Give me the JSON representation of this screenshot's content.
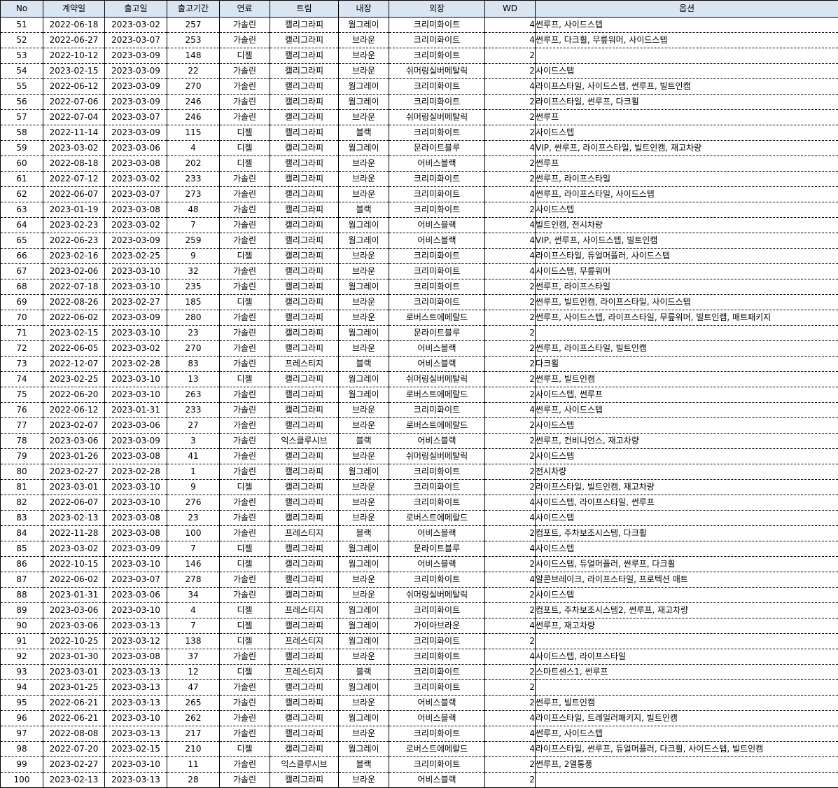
{
  "columns": [
    "No",
    "계약일",
    "출고일",
    "출고기간",
    "연료",
    "트림",
    "내장",
    "외장",
    "WD",
    "옵션"
  ],
  "rows": [
    [
      "51",
      "2022-06-18",
      "2023-03-02",
      "257",
      "가솔린",
      "캘리그라피",
      "웜그레이",
      "크리미화이트",
      "4",
      "썬루프, 사이드스텝"
    ],
    [
      "52",
      "2022-06-27",
      "2023-03-07",
      "253",
      "가솔린",
      "캘리그라피",
      "브라운",
      "크리미화이트",
      "4",
      "썬루프, 다크휠, 무릎워머, 사이드스텝"
    ],
    [
      "53",
      "2022-10-12",
      "2023-03-09",
      "148",
      "디젤",
      "캘리그라피",
      "브라운",
      "크리미화이트",
      "2",
      ""
    ],
    [
      "54",
      "2023-02-15",
      "2023-03-09",
      "22",
      "가솔린",
      "캘리그라피",
      "브라운",
      "쉬머링실버메탈릭",
      "2",
      "사이드스텝"
    ],
    [
      "55",
      "2022-06-12",
      "2023-03-09",
      "270",
      "가솔린",
      "캘리그라피",
      "웜그레이",
      "크리미화이트",
      "4",
      "라이프스타일, 사이드스텝, 썬루프, 빌트인캠"
    ],
    [
      "56",
      "2022-07-06",
      "2023-03-09",
      "246",
      "가솔린",
      "캘리그라피",
      "웜그레이",
      "크리미화이트",
      "2",
      "라이프스타일, 썬루프, 다크휠"
    ],
    [
      "57",
      "2022-07-04",
      "2023-03-07",
      "246",
      "가솔린",
      "캘리그라피",
      "브라운",
      "쉬머링실버메탈릭",
      "2",
      "썬루프"
    ],
    [
      "58",
      "2022-11-14",
      "2023-03-09",
      "115",
      "디젤",
      "캘리그라피",
      "블랙",
      "크리미화이트",
      "2",
      "사이드스텝"
    ],
    [
      "59",
      "2023-03-02",
      "2023-03-06",
      "4",
      "디젤",
      "캘리그라피",
      "웜그레이",
      "문라이트블루",
      "4",
      "VIP, 썬루프, 라이프스타일, 빌트인캠, 재고차량"
    ],
    [
      "60",
      "2022-08-18",
      "2023-03-08",
      "202",
      "디젤",
      "캘리그라피",
      "브라운",
      "어비스블랙",
      "2",
      "썬루프"
    ],
    [
      "61",
      "2022-07-12",
      "2023-03-02",
      "233",
      "가솔린",
      "캘리그라피",
      "브라운",
      "크리미화이트",
      "2",
      "썬루프, 라이프스타일"
    ],
    [
      "62",
      "2022-06-07",
      "2023-03-07",
      "273",
      "가솔린",
      "캘리그라피",
      "브라운",
      "크리미화이트",
      "4",
      "썬루프, 라이프스타일, 사이드스텝"
    ],
    [
      "63",
      "2023-01-19",
      "2023-03-08",
      "48",
      "가솔린",
      "캘리그라피",
      "블랙",
      "크리미화이트",
      "2",
      "사이드스텝"
    ],
    [
      "64",
      "2023-02-23",
      "2023-03-02",
      "7",
      "가솔린",
      "캘리그라피",
      "웜그레이",
      "어비스블랙",
      "4",
      "빌트인캠, 전시차량"
    ],
    [
      "65",
      "2022-06-23",
      "2023-03-09",
      "259",
      "가솔린",
      "캘리그라피",
      "웜그레이",
      "어비스블랙",
      "4",
      "VIP, 썬루프, 사이드스텝, 빌트인캠"
    ],
    [
      "66",
      "2023-02-16",
      "2023-02-25",
      "9",
      "디젤",
      "캘리그라피",
      "브라운",
      "크리미화이트",
      "4",
      "라이프스타일, 듀얼머플러, 사이드스텝"
    ],
    [
      "67",
      "2023-02-06",
      "2023-03-10",
      "32",
      "가솔린",
      "캘리그라피",
      "브라운",
      "크리미화이트",
      "4",
      "사이드스텝, 무릎워머"
    ],
    [
      "68",
      "2022-07-18",
      "2023-03-10",
      "235",
      "가솔린",
      "캘리그라피",
      "웜그레이",
      "크리미화이트",
      "2",
      "썬루프, 라이프스타일"
    ],
    [
      "69",
      "2022-08-26",
      "2023-02-27",
      "185",
      "디젤",
      "캘리그라피",
      "브라운",
      "크리미화이트",
      "2",
      "썬루프, 빌트인캠, 라이프스타일, 사이드스텝"
    ],
    [
      "70",
      "2022-06-02",
      "2023-03-09",
      "280",
      "가솔린",
      "캘리그라피",
      "브라운",
      "로버스트에메랄드",
      "2",
      "썬루프, 사이드스텝, 라이프스타일, 무릎워머, 빌트인캠, 매트패키지"
    ],
    [
      "71",
      "2023-02-15",
      "2023-03-10",
      "23",
      "가솔린",
      "캘리그라피",
      "웜그레이",
      "문라이트블루",
      "2",
      ""
    ],
    [
      "72",
      "2022-06-05",
      "2023-03-02",
      "270",
      "가솔린",
      "캘리그라피",
      "브라운",
      "어비스블랙",
      "2",
      "썬루프, 라이프스타일, 빌트인캠"
    ],
    [
      "73",
      "2022-12-07",
      "2023-02-28",
      "83",
      "가솔린",
      "프레스티지",
      "블랙",
      "어비스블랙",
      "2",
      "다크휠"
    ],
    [
      "74",
      "2023-02-25",
      "2023-03-10",
      "13",
      "디젤",
      "캘리그라피",
      "웜그레이",
      "쉬머링실버메탈릭",
      "2",
      "썬루프, 빌트인캠"
    ],
    [
      "75",
      "2022-06-20",
      "2023-03-10",
      "263",
      "가솔린",
      "캘리그라피",
      "웜그레이",
      "로버스트에메랄드",
      "2",
      "사이드스텝, 썬루프"
    ],
    [
      "76",
      "2022-06-12",
      "2023-01-31",
      "233",
      "가솔린",
      "캘리그라피",
      "브라운",
      "크리미화이트",
      "4",
      "썬루프, 사이드스텝"
    ],
    [
      "77",
      "2023-02-07",
      "2023-03-06",
      "27",
      "가솔린",
      "캘리그라피",
      "브라운",
      "로버스트에메랄드",
      "2",
      "사이드스텝"
    ],
    [
      "78",
      "2023-03-06",
      "2023-03-09",
      "3",
      "가솔린",
      "익스클루시브",
      "블랙",
      "어비스블랙",
      "2",
      "썬루프, 컨비니언스, 재고차량"
    ],
    [
      "79",
      "2023-01-26",
      "2023-03-08",
      "41",
      "가솔린",
      "캘리그라피",
      "브라운",
      "쉬머링실버메탈릭",
      "2",
      "사이드스텝"
    ],
    [
      "80",
      "2023-02-27",
      "2023-02-28",
      "1",
      "가솔린",
      "캘리그라피",
      "웜그레이",
      "크리미화이트",
      "2",
      "전시차량"
    ],
    [
      "81",
      "2023-03-01",
      "2023-03-10",
      "9",
      "디젤",
      "캘리그라피",
      "브라운",
      "크리미화이트",
      "2",
      "라이프스타일, 빌트인캠, 재고차량"
    ],
    [
      "82",
      "2022-06-07",
      "2023-03-10",
      "276",
      "가솔린",
      "캘리그라피",
      "브라운",
      "크리미화이트",
      "4",
      "사이드스텝, 라이프스타일, 썬루프"
    ],
    [
      "83",
      "2023-02-13",
      "2023-03-08",
      "23",
      "가솔린",
      "캘리그라피",
      "브라운",
      "로버스트에메랄드",
      "4",
      "사이드스텝"
    ],
    [
      "84",
      "2022-11-28",
      "2023-03-08",
      "100",
      "가솔린",
      "프레스티지",
      "블랙",
      "어비스블랙",
      "2",
      "컴포트, 주차보조시스템, 다크휠"
    ],
    [
      "85",
      "2023-03-02",
      "2023-03-09",
      "7",
      "디젤",
      "캘리그라피",
      "웜그레이",
      "문라이트블루",
      "4",
      "사이드스텝"
    ],
    [
      "86",
      "2022-10-15",
      "2023-03-10",
      "146",
      "디젤",
      "캘리그라피",
      "웜그레이",
      "어비스블랙",
      "2",
      "사이드스텝, 듀얼머플러, 썬루프, 다크휠"
    ],
    [
      "87",
      "2022-06-02",
      "2023-03-07",
      "278",
      "가솔린",
      "캘리그라피",
      "브라운",
      "크리미화이트",
      "4",
      "알콘브레이크, 라이프스타일, 프로텍션 매트"
    ],
    [
      "88",
      "2023-01-31",
      "2023-03-06",
      "34",
      "가솔린",
      "캘리그라피",
      "브라운",
      "쉬머링실버메탈릭",
      "2",
      "사이드스텝"
    ],
    [
      "89",
      "2023-03-06",
      "2023-03-10",
      "4",
      "디젤",
      "프레스티지",
      "웜그레이",
      "크리미화이트",
      "2",
      "컴포트, 주차보조시스템2, 썬루프, 재고차량"
    ],
    [
      "90",
      "2023-03-06",
      "2023-03-13",
      "7",
      "디젤",
      "캘리그라피",
      "웜그레이",
      "가이아브라운",
      "4",
      "썬루프, 재고차량"
    ],
    [
      "91",
      "2022-10-25",
      "2023-03-12",
      "138",
      "디젤",
      "프레스티지",
      "웜그레이",
      "크리미화이트",
      "2",
      ""
    ],
    [
      "92",
      "2023-01-30",
      "2023-03-08",
      "37",
      "가솔린",
      "캘리그라피",
      "브라운",
      "크리미화이트",
      "4",
      "사이드스텝, 라이프스타일"
    ],
    [
      "93",
      "2023-03-01",
      "2023-03-13",
      "12",
      "디젤",
      "프레스티지",
      "블랙",
      "크리미화이트",
      "2",
      "스마트센스1, 썬루프"
    ],
    [
      "94",
      "2023-01-25",
      "2023-03-13",
      "47",
      "가솔린",
      "캘리그라피",
      "웜그레이",
      "크리미화이트",
      "2",
      ""
    ],
    [
      "95",
      "2022-06-21",
      "2023-03-13",
      "265",
      "가솔린",
      "캘리그라피",
      "브라운",
      "어비스블랙",
      "2",
      "썬루프, 빌트인캠"
    ],
    [
      "96",
      "2022-06-21",
      "2023-03-10",
      "262",
      "가솔린",
      "캘리그라피",
      "웜그레이",
      "어비스블랙",
      "4",
      "라이프스타일, 트레일러패키지, 빌트인캠"
    ],
    [
      "97",
      "2022-08-08",
      "2023-03-13",
      "217",
      "가솔린",
      "캘리그라피",
      "브라운",
      "크리미화이트",
      "4",
      "썬루프, 사이드스텝"
    ],
    [
      "98",
      "2022-07-20",
      "2023-02-15",
      "210",
      "디젤",
      "캘리그라피",
      "웜그레이",
      "로버스트에메랄드",
      "4",
      "라이프스타일, 썬루프, 듀얼머플러, 다크휠, 사이드스텝, 빌트인캠"
    ],
    [
      "99",
      "2023-02-27",
      "2023-03-10",
      "11",
      "가솔린",
      "익스클루시브",
      "블랙",
      "크리미화이트",
      "2",
      "썬루프, 2열통풍"
    ],
    [
      "100",
      "2023-02-13",
      "2023-03-13",
      "28",
      "가솔린",
      "캘리그라피",
      "브라운",
      "어비스블랙",
      "2",
      ""
    ]
  ],
  "colors": {
    "header_bg": "#dae5f2",
    "border": "#000000"
  }
}
